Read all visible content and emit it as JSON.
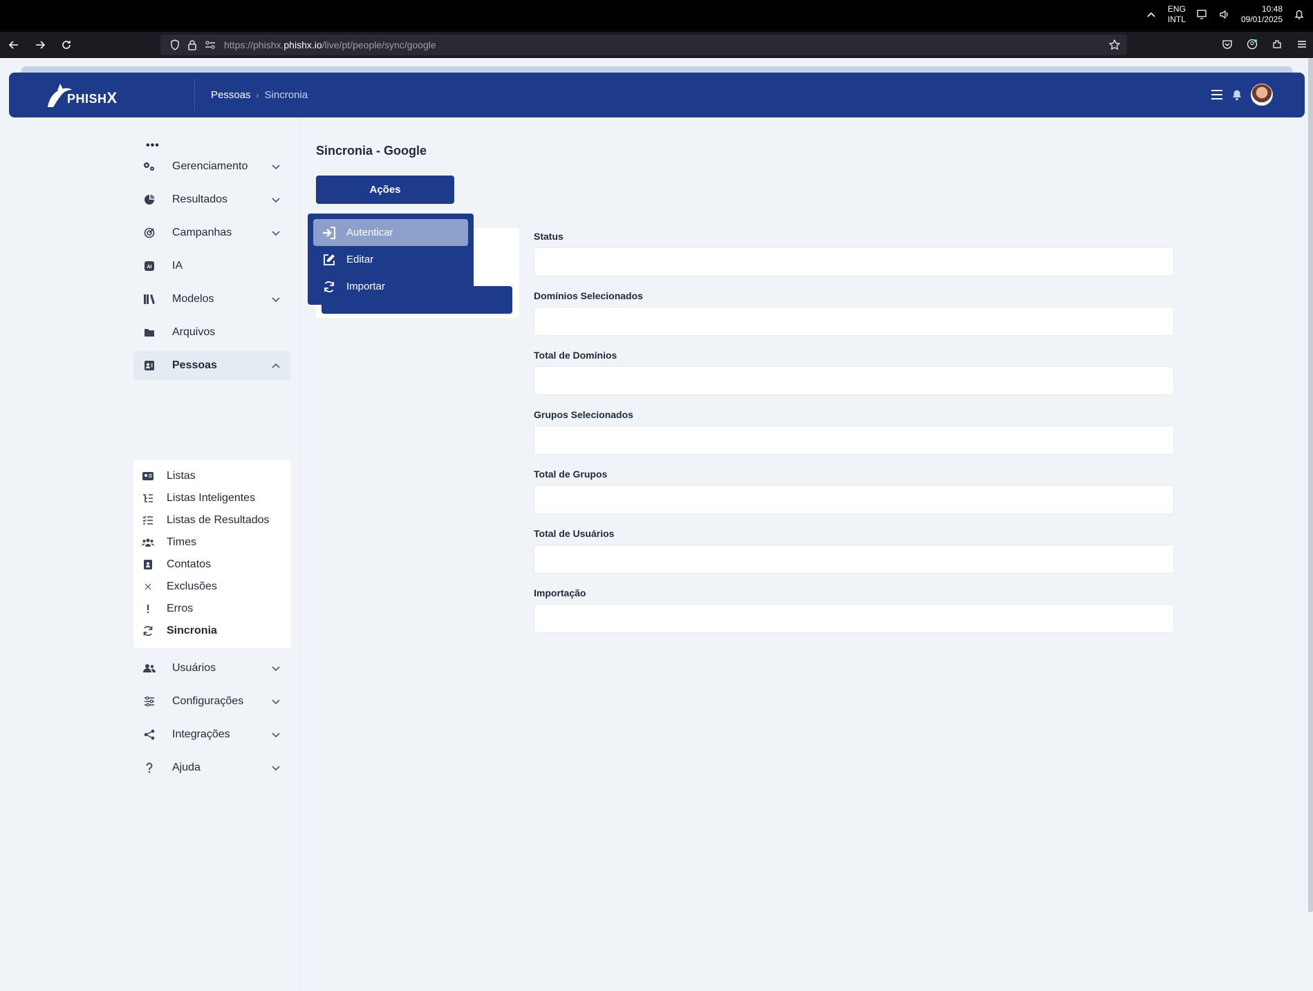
{
  "os": {
    "lang_top": "ENG",
    "lang_bottom": "INTL",
    "time": "10:48",
    "date": "09/01/2025"
  },
  "browser": {
    "url_prefix": "https://phishx.",
    "url_domain": "phishx.io",
    "url_path": "/live/pt/people/sync/google"
  },
  "header": {
    "logo_text": "PHISH",
    "logo_x": "X",
    "breadcrumb": [
      "Pessoas",
      "Sincronia"
    ]
  },
  "sidebar": {
    "more": "•••",
    "items": [
      {
        "label": "Gerenciamento",
        "icon": "gears-icon"
      },
      {
        "label": "Resultados",
        "icon": "pie-chart-icon"
      },
      {
        "label": "Campanhas",
        "icon": "target-icon"
      },
      {
        "label": "IA",
        "icon": "ai-icon"
      },
      {
        "label": "Modelos",
        "icon": "library-icon"
      },
      {
        "label": "Arquivos",
        "icon": "folder-icon"
      },
      {
        "label": "Pessoas",
        "icon": "contact-card-icon"
      },
      {
        "label": "Usuários",
        "icon": "users-icon"
      },
      {
        "label": "Configurações",
        "icon": "sliders-icon"
      },
      {
        "label": "Integrações",
        "icon": "share-nodes-icon"
      },
      {
        "label": "Ajuda",
        "icon": "question-icon"
      }
    ],
    "submenu": [
      {
        "label": "Listas",
        "icon": "id-card-icon"
      },
      {
        "label": "Listas Inteligentes",
        "icon": "list-tree-icon"
      },
      {
        "label": "Listas de Resultados",
        "icon": "list-check-icon"
      },
      {
        "label": "Times",
        "icon": "people-group-icon"
      },
      {
        "label": "Contatos",
        "icon": "address-book-icon"
      },
      {
        "label": "Exclusões",
        "icon": "x-icon"
      },
      {
        "label": "Erros",
        "icon": "exclamation-icon"
      },
      {
        "label": "Sincronia",
        "icon": "sync-icon"
      }
    ]
  },
  "main": {
    "title": "Sincronia - Google",
    "actions_button": "Ações",
    "dropdown": [
      {
        "label": "Autenticar",
        "icon": "sign-in-icon"
      },
      {
        "label": "Editar",
        "icon": "edit-icon"
      },
      {
        "label": "Importar",
        "icon": "sync-icon"
      }
    ],
    "fields": [
      {
        "label": "Status",
        "value": ""
      },
      {
        "label": "Domínios Selecionados",
        "value": ""
      },
      {
        "label": "Total de Domínios",
        "value": ""
      },
      {
        "label": "Grupos Selecionados",
        "value": ""
      },
      {
        "label": "Total de Grupos",
        "value": ""
      },
      {
        "label": "Total de Usuários",
        "value": ""
      },
      {
        "label": "Importação",
        "value": ""
      }
    ]
  },
  "colors": {
    "brand": "#1e3a8a",
    "dropdown_highlight": "#8da0cc",
    "background": "#f0f4f9"
  }
}
